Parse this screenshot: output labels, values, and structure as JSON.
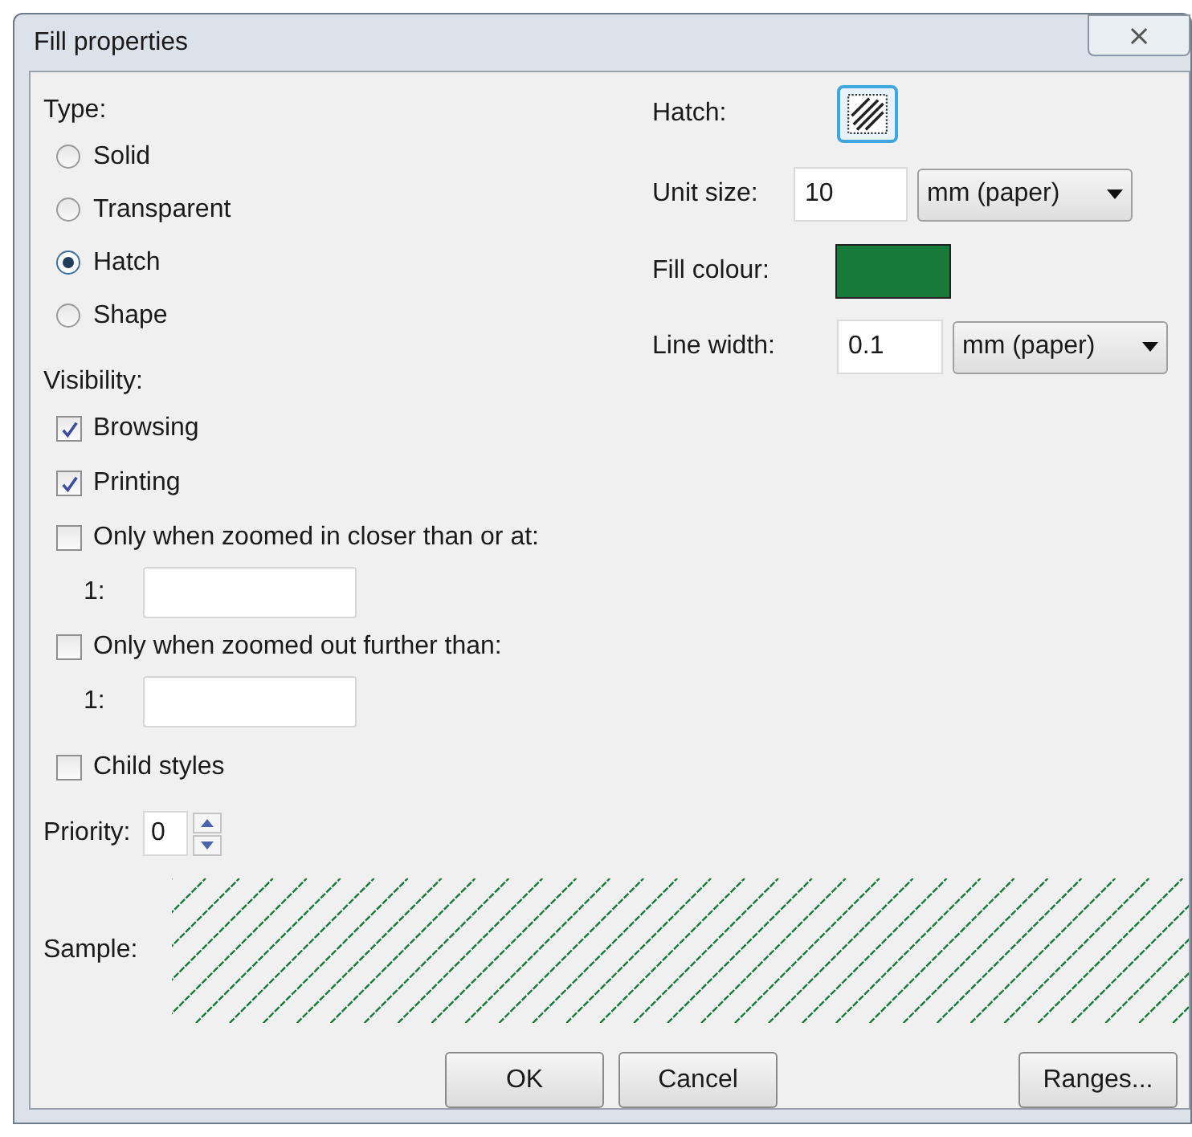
{
  "window": {
    "title": "Fill properties",
    "close": "⨯"
  },
  "type": {
    "label": "Type:",
    "options": [
      {
        "label": "Solid",
        "selected": false
      },
      {
        "label": "Transparent",
        "selected": false
      },
      {
        "label": "Hatch",
        "selected": true
      },
      {
        "label": "Shape",
        "selected": false
      }
    ]
  },
  "visibility": {
    "label": "Visibility:",
    "items": [
      {
        "kind": "check",
        "label": "Browsing",
        "checked": true
      },
      {
        "kind": "check",
        "label": "Printing",
        "checked": true
      },
      {
        "kind": "check",
        "label": "Only when zoomed in closer than or at:",
        "checked": false
      },
      {
        "kind": "scale",
        "prefix": "1:"
      },
      {
        "kind": "check",
        "label": "Only when zoomed out further than:",
        "checked": false
      },
      {
        "kind": "scale",
        "prefix": "1:"
      }
    ]
  },
  "child_styles": {
    "label": "Child styles",
    "checked": false
  },
  "priority": {
    "label": "Priority:",
    "value": "0"
  },
  "hatch": {
    "label": "Hatch:"
  },
  "unit_size": {
    "label": "Unit size:",
    "value": "10",
    "unit": "mm (paper)"
  },
  "fill_colour": {
    "label": "Fill colour:",
    "color": "#187a3a"
  },
  "line_width": {
    "label": "Line width:",
    "value": "0.1",
    "unit": "mm (paper)"
  },
  "sample": {
    "label": "Sample:"
  },
  "buttons": [
    {
      "label": "OK"
    },
    {
      "label": "Cancel"
    }
  ],
  "ranges_button": {
    "label": "Ranges..."
  }
}
